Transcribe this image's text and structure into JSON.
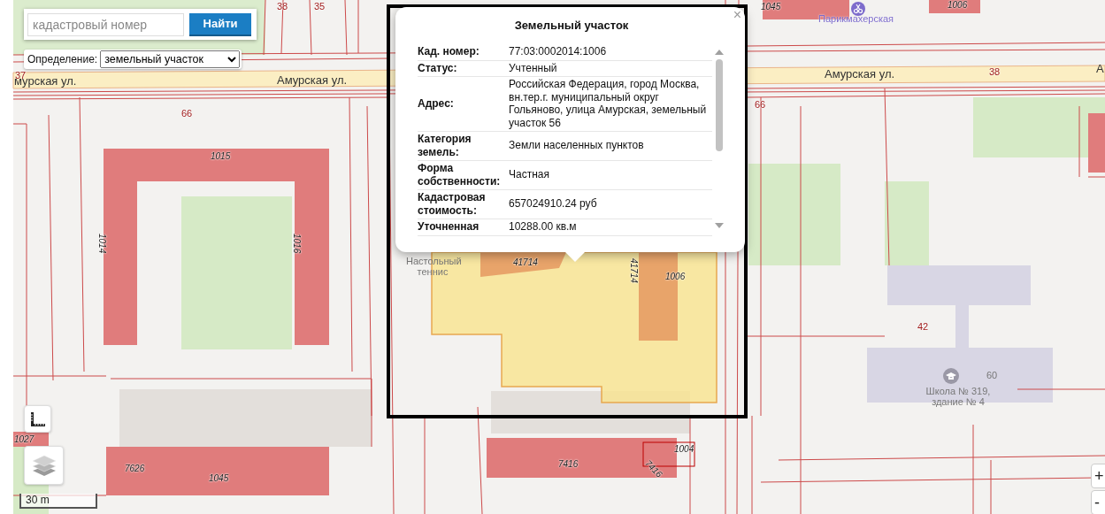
{
  "search": {
    "placeholder": "кадастровый номер",
    "button": "Найти"
  },
  "definition": {
    "label": "Определение:",
    "value": "земельный участок"
  },
  "popup": {
    "title": "Земельный участок",
    "close": "×",
    "rows": [
      {
        "label": "Кад. номер:",
        "value": "77:03:0002014:1006"
      },
      {
        "label": "Статус:",
        "value": "Учтенный"
      },
      {
        "label": "Адрес:",
        "value": "Российская Федерация, город Москва, вн.тер.г. муниципальный округ Гольяново, улица Амурская, земельный участок 56"
      },
      {
        "label": "Категория земель:",
        "value": "Земли населенных пунктов"
      },
      {
        "label": "Форма собственности:",
        "value": "Частная"
      },
      {
        "label": "Кадастровая стоимость:",
        "value": "657024910.24 руб"
      },
      {
        "label": "Уточненная",
        "value": "10288.00 кв.м"
      }
    ]
  },
  "map_labels": [
    {
      "text": "38",
      "kind": "address"
    },
    {
      "text": "35",
      "kind": "address"
    },
    {
      "text": "37",
      "kind": "address"
    },
    {
      "text": "мурская ул.",
      "kind": "street"
    },
    {
      "text": "Амурская ул.",
      "kind": "street"
    },
    {
      "text": "Амурская ул.",
      "kind": "street"
    },
    {
      "text": "А",
      "kind": "street"
    },
    {
      "text": "66",
      "kind": "address"
    },
    {
      "text": "66",
      "kind": "address"
    },
    {
      "text": "38",
      "kind": "address"
    },
    {
      "text": "1045",
      "kind": "building"
    },
    {
      "text": "Парикмахерская",
      "kind": "poi"
    },
    {
      "text": "1006",
      "kind": "building"
    },
    {
      "text": "1015",
      "kind": "building"
    },
    {
      "text": "1014",
      "kind": "building"
    },
    {
      "text": "1016",
      "kind": "building"
    },
    {
      "text": "41714",
      "kind": "building"
    },
    {
      "text": "41714",
      "kind": "building"
    },
    {
      "text": "1006",
      "kind": "building"
    },
    {
      "text": "Настольный теннис",
      "kind": "place"
    },
    {
      "text": "42",
      "kind": "address"
    },
    {
      "text": "60",
      "kind": "place"
    },
    {
      "text": "Школа № 319, здание № 4",
      "kind": "place"
    },
    {
      "text": "1027",
      "kind": "building"
    },
    {
      "text": "7626",
      "kind": "building"
    },
    {
      "text": "1045",
      "kind": "building"
    },
    {
      "text": "7416",
      "kind": "building"
    },
    {
      "text": "7416",
      "kind": "building"
    },
    {
      "text": "1004",
      "kind": "building"
    }
  ],
  "scale": "30 m",
  "zoom": [
    "+",
    "-"
  ]
}
